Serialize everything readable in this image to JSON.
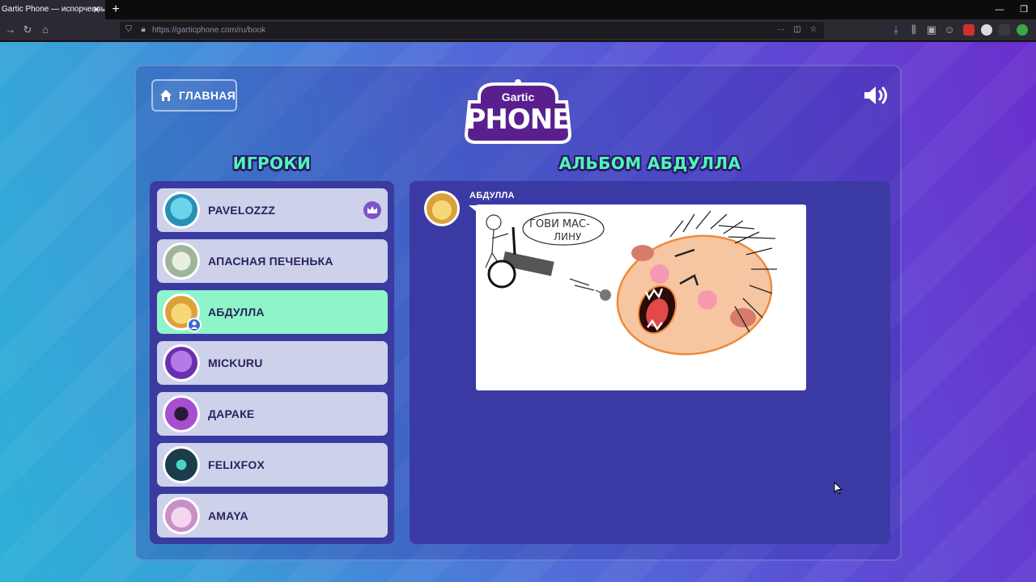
{
  "browser": {
    "tab_title": "Gartic Phone — испорченный",
    "tab_close": "✕",
    "new_tab": "+",
    "url": "https://garticphone.com/ru/book",
    "window_buttons": [
      "—",
      "❐"
    ]
  },
  "header": {
    "home_label": "ГЛАВНАЯ",
    "logo_top": "Gartic",
    "logo_main": "PHONE",
    "sound_icon": "speaker-icon"
  },
  "players_section": {
    "title": "ИГРОКИ",
    "players": [
      {
        "name": "PAVELOZZZ",
        "host": true,
        "active": false,
        "avatar_color": "#3ab6d9"
      },
      {
        "name": "АПАСНАЯ ПЕЧЕНЬКА",
        "host": false,
        "active": false,
        "avatar_color": "#c9d8c2"
      },
      {
        "name": "АБДУЛЛА",
        "host": false,
        "active": true,
        "avatar_color": "#f0c04a"
      },
      {
        "name": "MICKURU",
        "host": false,
        "active": false,
        "avatar_color": "#9a4fd6"
      },
      {
        "name": "ДАРАКЕ",
        "host": false,
        "active": false,
        "avatar_color": "#8e3fb0"
      },
      {
        "name": "FELIXFOX",
        "host": false,
        "active": false,
        "avatar_color": "#1f6f7c"
      },
      {
        "name": "AMAYA",
        "host": false,
        "active": false,
        "avatar_color": "#e9c3e8"
      }
    ]
  },
  "album_section": {
    "title": "АЛЬБОМ АБДУЛЛА",
    "entry_author": "АБДУЛЛА",
    "drawing_text_line1": "ГОВИ МАС-",
    "drawing_text_line2": "ЛИНУ"
  },
  "colors": {
    "accent_green": "#4ef7b4",
    "active_row": "#8ef5c8",
    "panel": "#3a3aa0",
    "title_text": "#2a2260"
  }
}
